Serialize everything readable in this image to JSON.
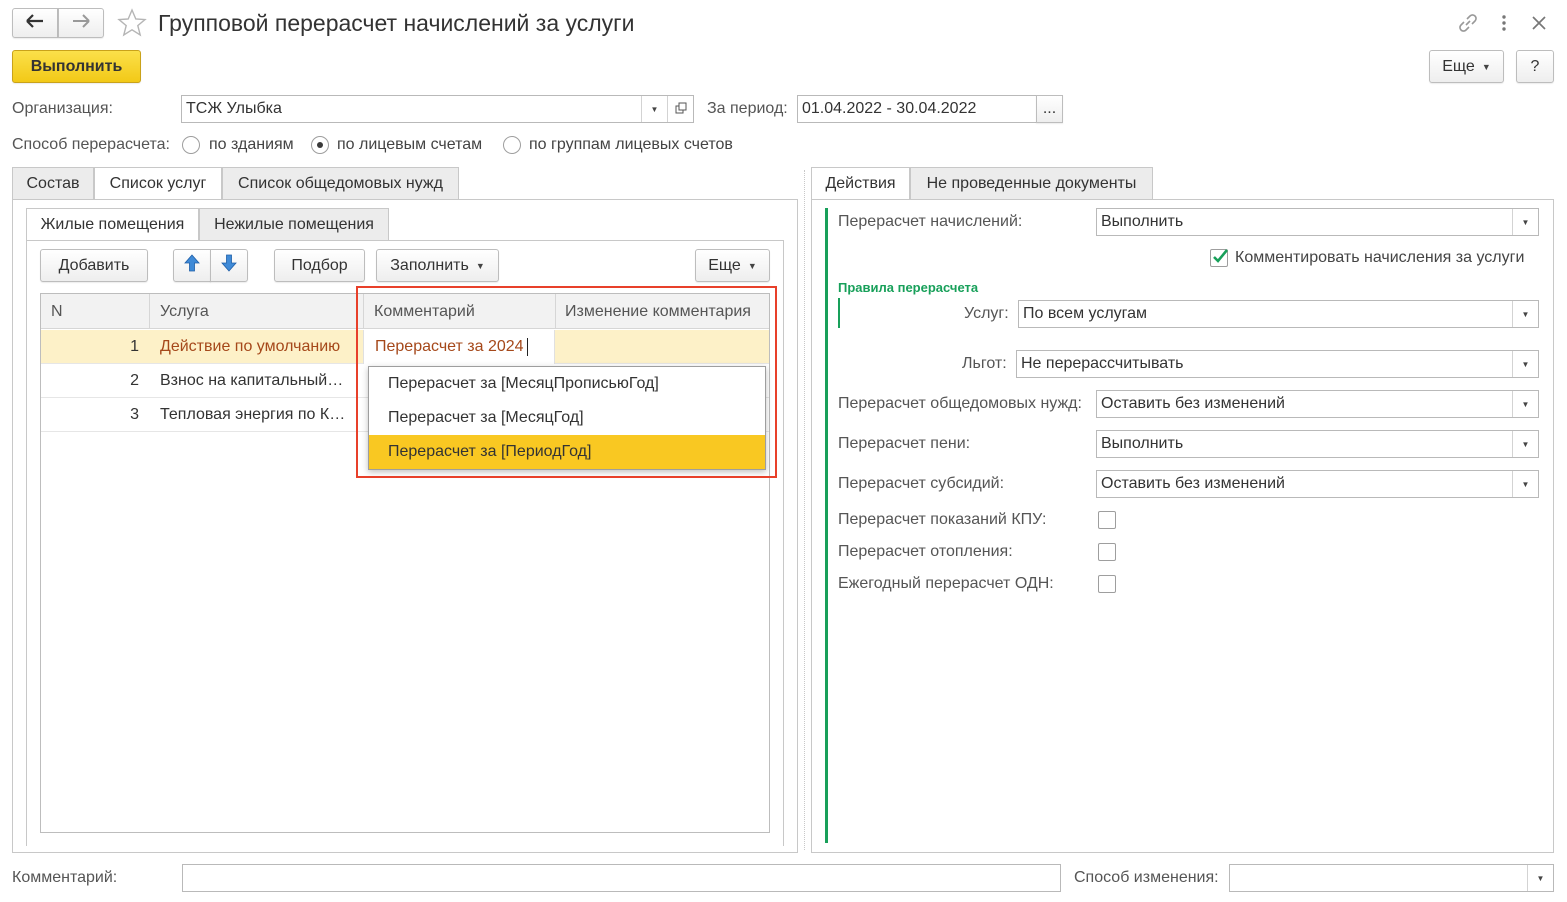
{
  "window": {
    "title": "Групповой перерасчет начислений за услуги",
    "icons": [
      "arrow-left-icon",
      "arrow-right-icon",
      "star-icon",
      "link-icon",
      "more-vert-icon",
      "close-icon"
    ]
  },
  "toolbar": {
    "execute_label": "Выполнить",
    "more_label": "Еще",
    "help_label": "?"
  },
  "header": {
    "org_label": "Организация:",
    "org_value": "ТСЖ Улыбка",
    "period_label": "За период:",
    "period_value": "01.04.2022 - 30.04.2022",
    "period_button": "...",
    "method_label": "Способ перерасчета:",
    "method_options": [
      "по зданиям",
      "по лицевым счетам",
      "по группам лицевых счетов"
    ],
    "method_selected": "по лицевым счетам"
  },
  "left_tabs": [
    "Состав",
    "Список услуг",
    "Список общедомовых нужд"
  ],
  "left_active_tab": "Список услуг",
  "sub_tabs": [
    "Жилые помещения",
    "Нежилые помещения"
  ],
  "sub_active_tab": "Жилые помещения",
  "grid_toolbar": {
    "add": "Добавить",
    "select": "Подбор",
    "fill": "Заполнить",
    "more": "Еще"
  },
  "grid": {
    "columns": [
      "N",
      "Услуга",
      "Комментарий",
      "Изменение комментария"
    ],
    "rows": [
      {
        "n": "1",
        "service": "Действие по умолчанию",
        "comment": "Перерасчет за 2024",
        "change": ""
      },
      {
        "n": "2",
        "service": "Взнос на капитальный…",
        "comment": "",
        "change": ""
      },
      {
        "n": "3",
        "service": "Тепловая энергия по К…",
        "comment": "",
        "change": ""
      }
    ]
  },
  "autocomplete": {
    "items": [
      "Перерасчет за [МесяцПрописьюГод]",
      "Перерасчет за [МесяцГод]",
      "Перерасчет за [ПериодГод]"
    ],
    "highlighted_index": 2
  },
  "right_tabs": [
    "Действия",
    "Не проведенные документы"
  ],
  "right_active_tab": "Действия",
  "actions": {
    "recalc_label": "Перерасчет начислений:",
    "recalc_value": "Выполнить",
    "comment_check_label": "Комментировать начисления за услуги",
    "comment_checked": true,
    "rules_title": "Правила перерасчета",
    "services_label": "Услуг:",
    "services_value": "По всем услугам",
    "benefits_label": "Льгот:",
    "benefits_value": "Не перерассчитывать",
    "common_label": "Перерасчет общедомовых нужд:",
    "common_value": "Оставить без изменений",
    "penalty_label": "Перерасчет пени:",
    "penalty_value": "Выполнить",
    "subsidy_label": "Перерасчет субсидий:",
    "subsidy_value": "Оставить без изменений",
    "meters_label": "Перерасчет показаний КПУ:",
    "heating_label": "Перерасчет отопления:",
    "annual_label": "Ежегодный перерасчет ОДН:"
  },
  "footer": {
    "comment_label": "Комментарий:",
    "comment_value": "",
    "change_label": "Способ изменения:",
    "change_value": ""
  },
  "colors": {
    "accent_yellow": "#f5d02a",
    "row_highlight": "#fdf1c8",
    "popup_highlight": "#f9c822",
    "rules_green": "#18a05a",
    "annotation_red": "#e8402a",
    "service_text": "#a5481a"
  }
}
